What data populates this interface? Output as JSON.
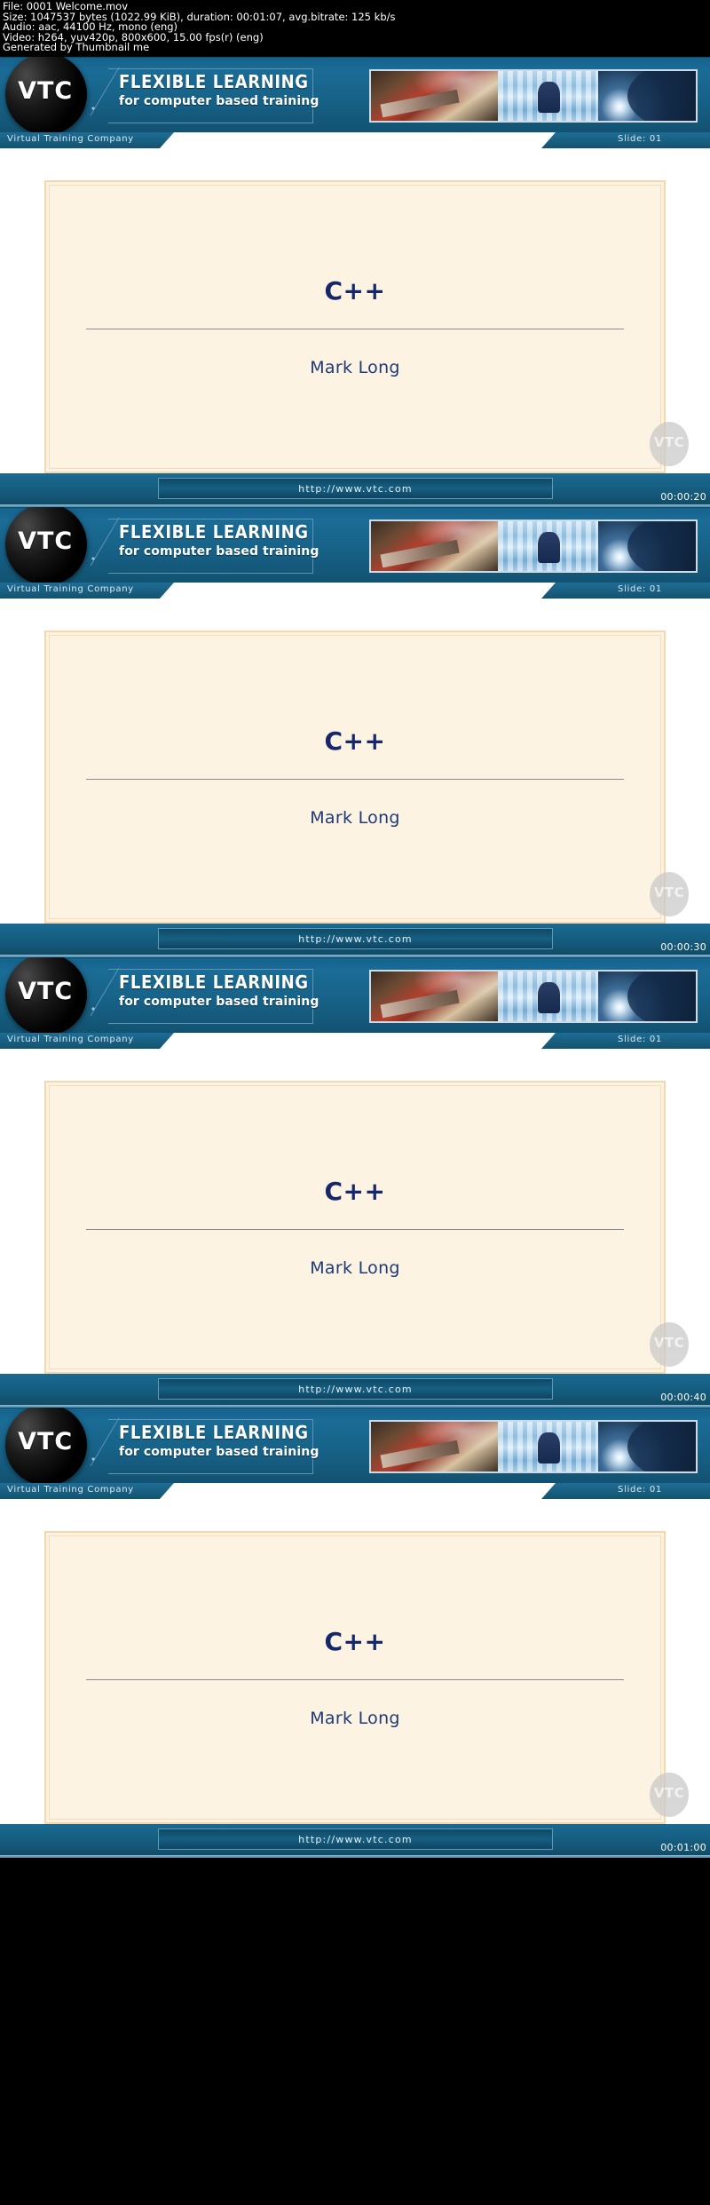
{
  "metadata": {
    "lines": [
      "File: 0001 Welcome.mov",
      "Size: 1047537 bytes (1022.99 KiB), duration: 00:01:07, avg.bitrate: 125 kb/s",
      "Audio: aac, 44100 Hz, mono (eng)",
      "Video: h264, yuv420p, 800x600, 15.00 fps(r) (eng)",
      "Generated by Thumbnail me"
    ]
  },
  "banner": {
    "logo_text": "VTC",
    "tagline_primary": "FLEXIBLE LEARNING",
    "tagline_secondary": "for computer based training",
    "photo_alt_1": "hand-on-keyboard-photo",
    "photo_alt_2": "businessman-glass-building-photo",
    "photo_alt_3": "bridge-sunset-photo"
  },
  "slidebar": {
    "company": "Virtual Training Company",
    "slide_label": "Slide: 01"
  },
  "slide": {
    "title": "C++",
    "author": "Mark Long",
    "watermark": "VTC"
  },
  "footer": {
    "url": "http://www.vtc.com"
  },
  "colors": {
    "banner_blue": "#176288",
    "card_bg": "#fdf3e2",
    "card_border": "#f7d7ae",
    "title_navy": "#16276b",
    "author_navy": "#1d3a77",
    "black_header": "#000000"
  },
  "frames": [
    {
      "timestamp": "00:00:20",
      "slide_height": 330
    },
    {
      "timestamp": "00:00:30",
      "slide_height": 330
    },
    {
      "timestamp": "00:00:40",
      "slide_height": 330
    },
    {
      "timestamp": "00:01:00",
      "slide_height": 330
    }
  ]
}
